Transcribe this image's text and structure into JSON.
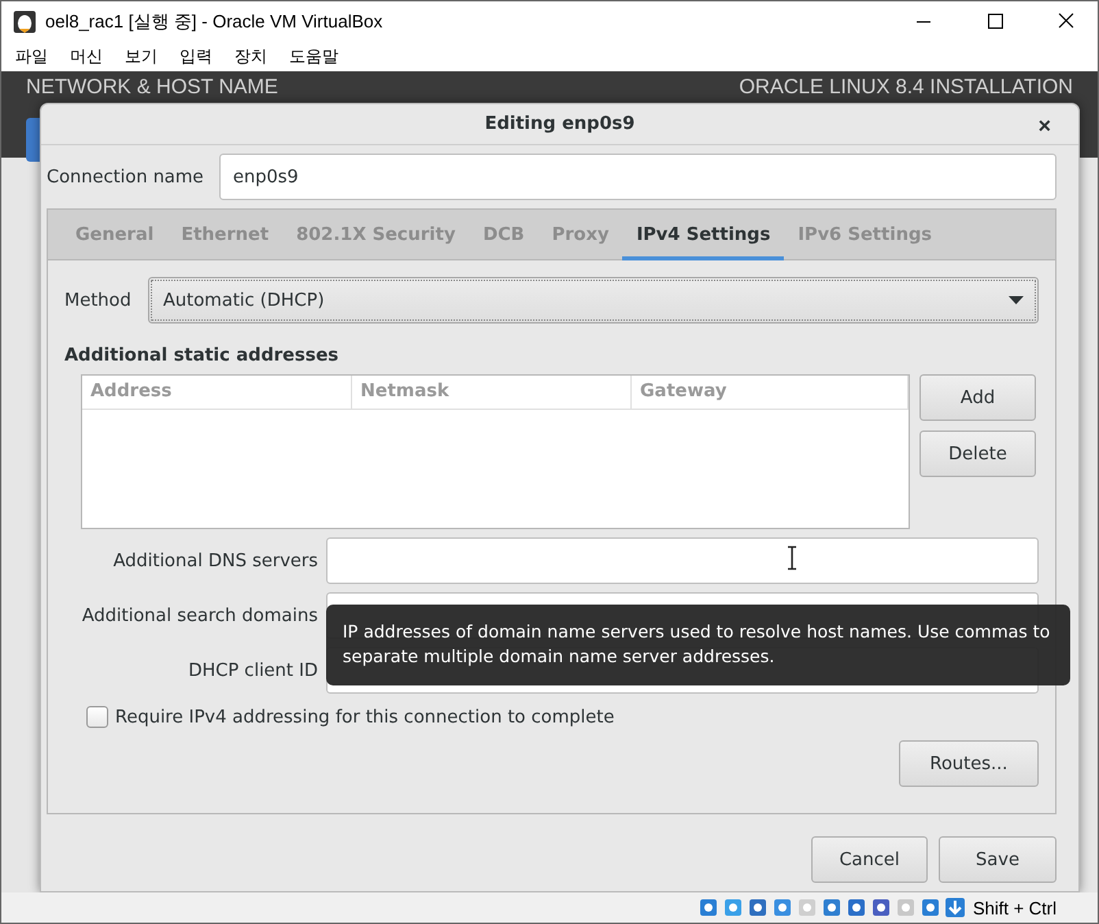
{
  "window": {
    "title": "oel8_rac1 [실행 중] - Oracle VM VirtualBox"
  },
  "menu": [
    "파일",
    "머신",
    "보기",
    "입력",
    "장치",
    "도움말"
  ],
  "installer": {
    "left_title": "NETWORK & HOST NAME",
    "right_title": "ORACLE LINUX 8.4 INSTALLATION"
  },
  "dialog": {
    "title": "Editing enp0s9",
    "close": "×",
    "connection_name": {
      "label": "Connection name",
      "value": "enp0s9"
    },
    "tabs": [
      {
        "label": "General",
        "selected": false
      },
      {
        "label": "Ethernet",
        "selected": false
      },
      {
        "label": "802.1X Security",
        "selected": false
      },
      {
        "label": "DCB",
        "selected": false
      },
      {
        "label": "Proxy",
        "selected": false
      },
      {
        "label": "IPv4 Settings",
        "selected": true
      },
      {
        "label": "IPv6 Settings",
        "selected": false
      }
    ],
    "method": {
      "label": "Method",
      "value": "Automatic (DHCP)"
    },
    "section_title": "Additional static addresses",
    "table": {
      "columns": [
        "Address",
        "Netmask",
        "Gateway"
      ]
    },
    "table_buttons": [
      "Add",
      "Delete"
    ],
    "fields": [
      {
        "label": "Additional DNS servers"
      },
      {
        "label": "Additional search domains"
      },
      {
        "label": "DHCP client ID"
      }
    ],
    "checkbox": {
      "label": "Require IPv4 addressing for this connection to complete",
      "checked": false
    },
    "routes_button": "Routes...",
    "buttons": [
      "Cancel",
      "Save"
    ]
  },
  "tooltip": "IP addresses of domain name servers used to resolve host names. Use commas to separate multiple domain name server addresses.",
  "status_bar": {
    "host_key": "Shift + Ctrl"
  }
}
